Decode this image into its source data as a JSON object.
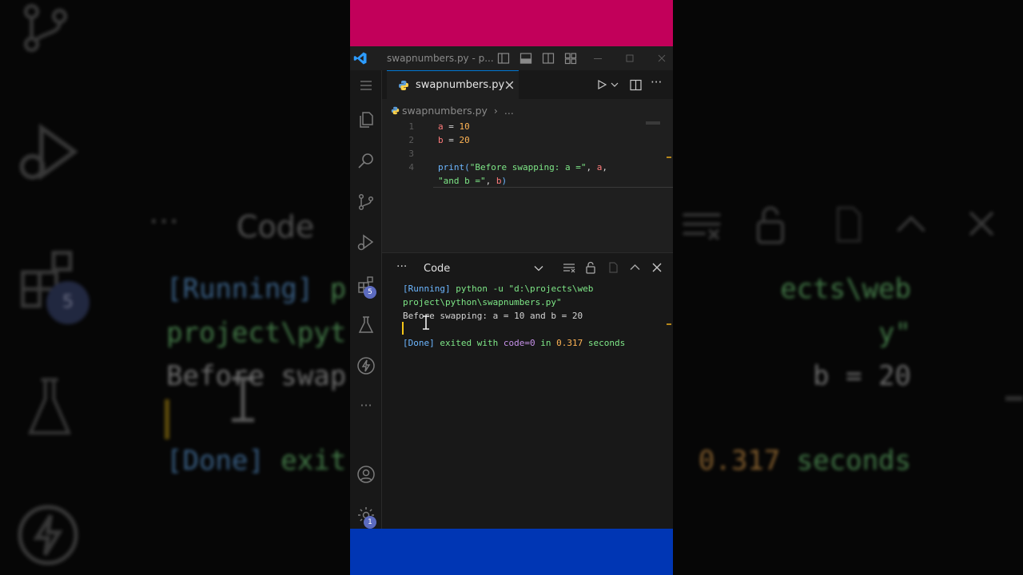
{
  "window": {
    "title": "swapnumbers.py - p..."
  },
  "editor": {
    "tab_label": "swapnumbers.py",
    "breadcrumb_file": "swapnumbers.py",
    "breadcrumb_more": "...",
    "lines": [
      {
        "num": "1",
        "segs": [
          {
            "t": "a",
            "c": "#ff7b7b"
          },
          {
            "t": " = ",
            "c": "#d4d4d4"
          },
          {
            "t": "10",
            "c": "#ffb454"
          }
        ]
      },
      {
        "num": "2",
        "segs": [
          {
            "t": "b",
            "c": "#ff7b7b"
          },
          {
            "t": " = ",
            "c": "#d4d4d4"
          },
          {
            "t": "20",
            "c": "#ffb454"
          }
        ]
      },
      {
        "num": "3",
        "segs": []
      },
      {
        "num": "4",
        "segs": [
          {
            "t": "print(",
            "c": "#6cb6ff"
          },
          {
            "t": "\"Before swapping: a =\"",
            "c": "#7ee787"
          },
          {
            "t": ", ",
            "c": "#d4d4d4"
          },
          {
            "t": "a",
            "c": "#ff7b7b"
          },
          {
            "t": ",",
            "c": "#d4d4d4"
          }
        ]
      },
      {
        "num": "",
        "segs": [
          {
            "t": "\"and b =\"",
            "c": "#7ee787"
          },
          {
            "t": ", ",
            "c": "#d4d4d4"
          },
          {
            "t": "b",
            "c": "#ff7b7b"
          },
          {
            "t": ")",
            "c": "#6cb6ff"
          }
        ]
      }
    ]
  },
  "activity": {
    "source_control_badge": "5",
    "settings_badge": "1"
  },
  "panel": {
    "dropdown_value": "Code",
    "more_label": "···",
    "output": [
      {
        "segs": [
          {
            "t": "[Running] ",
            "c": "#6cb6ff"
          },
          {
            "t": "python -u \"d:\\projects\\web",
            "c": "#7ee787"
          }
        ]
      },
      {
        "segs": [
          {
            "t": "project\\python\\swapnumbers.py\"",
            "c": "#7ee787"
          }
        ]
      },
      {
        "segs": [
          {
            "t": "Before swapping: a = 10 and b = 20",
            "c": "#d4d4d4"
          }
        ]
      },
      {
        "segs": []
      },
      {
        "segs": [
          {
            "t": "[Done] ",
            "c": "#6cb6ff"
          },
          {
            "t": "exited with ",
            "c": "#7ee787"
          },
          {
            "t": "code=0",
            "c": "#c792ea"
          },
          {
            "t": " in ",
            "c": "#7ee787"
          },
          {
            "t": "0.317",
            "c": "#ffb454"
          },
          {
            "t": " seconds",
            "c": "#7ee787"
          }
        ]
      }
    ]
  },
  "background": {
    "code_label": "Code",
    "badge": "5",
    "lines": [
      {
        "segs": [
          {
            "t": "[Running] ",
            "c": "#6cb6ff"
          },
          {
            "t": "p",
            "c": "#7ee787"
          }
        ]
      },
      {
        "segs": [
          {
            "t": "project\\pyt",
            "c": "#7ee787"
          }
        ]
      },
      {
        "segs": [
          {
            "t": "Before swap",
            "c": "#d4d4d4"
          }
        ]
      },
      {
        "segs": [
          {
            "t": "[Done] ",
            "c": "#6cb6ff"
          },
          {
            "t": "exit",
            "c": "#7ee787"
          }
        ]
      }
    ],
    "right_lines": [
      {
        "segs": [
          {
            "t": "ects\\web",
            "c": "#7ee787"
          }
        ]
      },
      {
        "segs": [
          {
            "t": "y\"",
            "c": "#7ee787"
          }
        ]
      },
      {
        "segs": [
          {
            "t": "b = 20",
            "c": "#d4d4d4"
          }
        ]
      },
      {
        "segs": [
          {
            "t": "0.317",
            "c": "#ffb454"
          },
          {
            "t": " seconds",
            "c": "#7ee787"
          }
        ]
      }
    ]
  },
  "colors": {
    "top_band": "#c2005a",
    "bottom_band": "#0036b4",
    "accent": "#0078d4",
    "cursor": "#f5c518"
  }
}
